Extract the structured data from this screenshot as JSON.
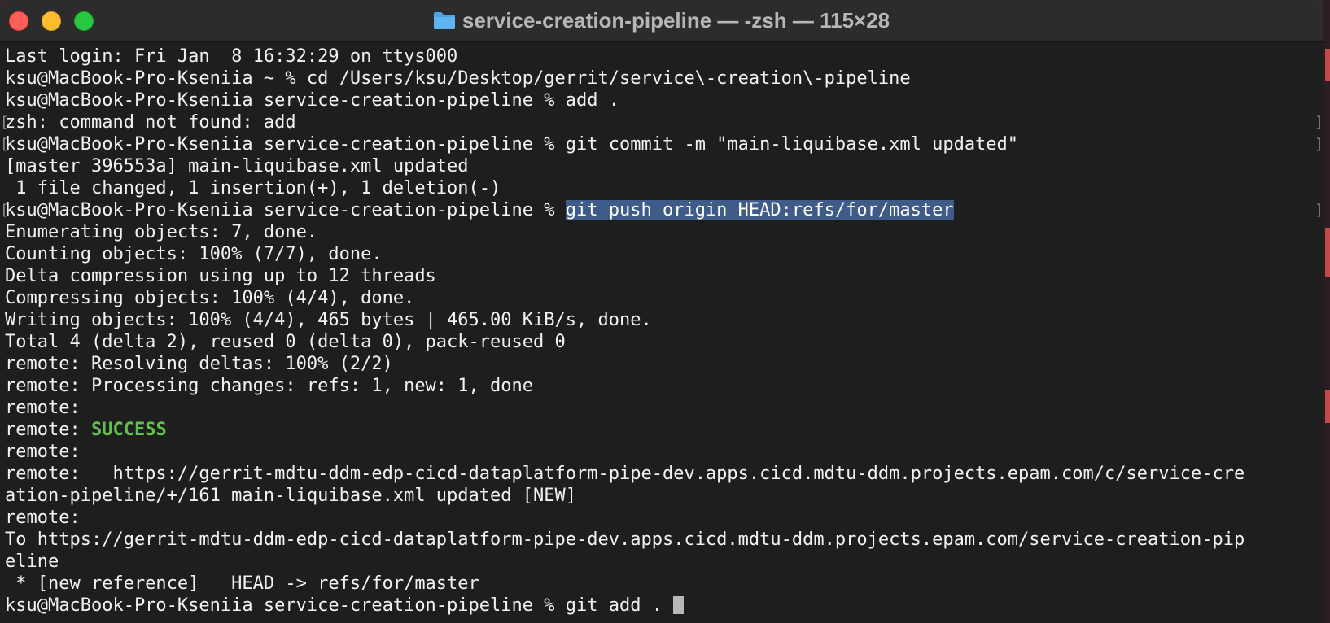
{
  "window": {
    "title": "service-creation-pipeline — -zsh — 115×28"
  },
  "terminal": {
    "lines": [
      "Last login: Fri Jan  8 16:32:29 on ttys000",
      "ksu@MacBook-Pro-Kseniia ~ % cd /Users/ksu/Desktop/gerrit/service\\-creation\\-pipeline",
      "ksu@MacBook-Pro-Kseniia service-creation-pipeline % add .",
      "zsh: command not found: add",
      "ksu@MacBook-Pro-Kseniia service-creation-pipeline % git commit -m \"main-liquibase.xml updated\"",
      "[master 396553a] main-liquibase.xml updated",
      " 1 file changed, 1 insertion(+), 1 deletion(-)",
      "ksu@MacBook-Pro-Kseniia service-creation-pipeline % ",
      "Enumerating objects: 7, done.",
      "Counting objects: 100% (7/7), done.",
      "Delta compression using up to 12 threads",
      "Compressing objects: 100% (4/4), done.",
      "Writing objects: 100% (4/4), 465 bytes | 465.00 KiB/s, done.",
      "Total 4 (delta 2), reused 0 (delta 0), pack-reused 0",
      "remote: Resolving deltas: 100% (2/2)",
      "remote: Processing changes: refs: 1, new: 1, done",
      "remote:",
      "remote: ",
      "remote:",
      "remote:   https://gerrit-mdtu-ddm-edp-cicd-dataplatform-pipe-dev.apps.cicd.mdtu-ddm.projects.epam.com/c/service-cre",
      "ation-pipeline/+/161 main-liquibase.xml updated [NEW]",
      "remote:",
      "To https://gerrit-mdtu-ddm-edp-cicd-dataplatform-pipe-dev.apps.cicd.mdtu-ddm.projects.epam.com/service-creation-pip",
      "eline",
      " * [new reference]   HEAD -> refs/for/master",
      "ksu@MacBook-Pro-Kseniia service-creation-pipeline % git add . "
    ],
    "selected_command": "git push origin HEAD:refs/for/master",
    "success_text": "SUCCESS",
    "colors": {
      "background": "#1e1e1e",
      "foreground": "#f2f2f2",
      "selection": "#3e5b8a",
      "success": "#5fc34a"
    }
  }
}
